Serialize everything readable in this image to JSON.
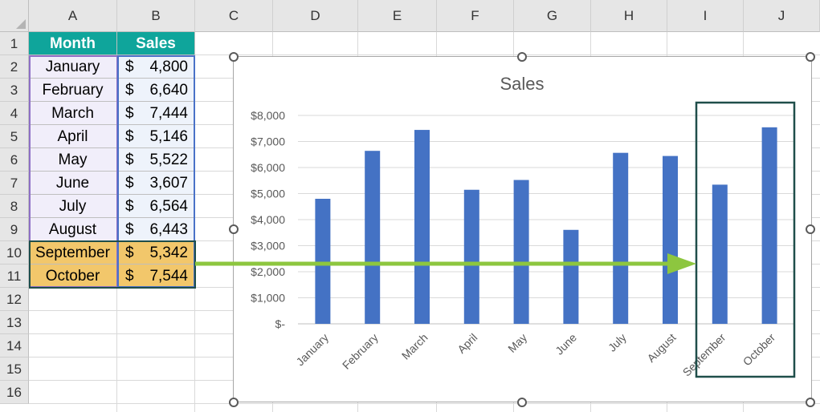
{
  "columns": [
    "A",
    "B",
    "C",
    "D",
    "E",
    "F",
    "G",
    "H",
    "I",
    "J"
  ],
  "rows": [
    "1",
    "2",
    "3",
    "4",
    "5",
    "6",
    "7",
    "8",
    "9",
    "10",
    "11",
    "12",
    "13",
    "14",
    "15",
    "16"
  ],
  "table": {
    "headers": {
      "month": "Month",
      "sales": "Sales"
    },
    "currency": "$",
    "rows": [
      {
        "month": "January",
        "sales": "4,800"
      },
      {
        "month": "February",
        "sales": "6,640"
      },
      {
        "month": "March",
        "sales": "7,444"
      },
      {
        "month": "April",
        "sales": "5,146"
      },
      {
        "month": "May",
        "sales": "5,522"
      },
      {
        "month": "June",
        "sales": "3,607"
      },
      {
        "month": "July",
        "sales": "6,564"
      },
      {
        "month": "August",
        "sales": "6,443"
      },
      {
        "month": "September",
        "sales": "5,342"
      },
      {
        "month": "October",
        "sales": "7,544"
      }
    ]
  },
  "colors": {
    "header_fill": "#0fa59b",
    "highlight_fill": "#f2c76b",
    "bar": "#4472c4",
    "arrow": "#8dc63f",
    "focus_box": "#1f4e4a"
  },
  "chart_data": {
    "type": "bar",
    "title": "Sales",
    "categories": [
      "January",
      "February",
      "March",
      "April",
      "May",
      "June",
      "July",
      "August",
      "September",
      "October"
    ],
    "values": [
      4800,
      6640,
      7444,
      5146,
      5522,
      3607,
      6564,
      6443,
      5342,
      7544
    ],
    "ylim": [
      0,
      8000
    ],
    "ytick_labels": [
      "$-",
      "$1,000",
      "$2,000",
      "$3,000",
      "$4,000",
      "$5,000",
      "$6,000",
      "$7,000",
      "$8,000"
    ],
    "ytick_values": [
      0,
      1000,
      2000,
      3000,
      4000,
      5000,
      6000,
      7000,
      8000
    ],
    "grid": true,
    "legend": "none"
  }
}
